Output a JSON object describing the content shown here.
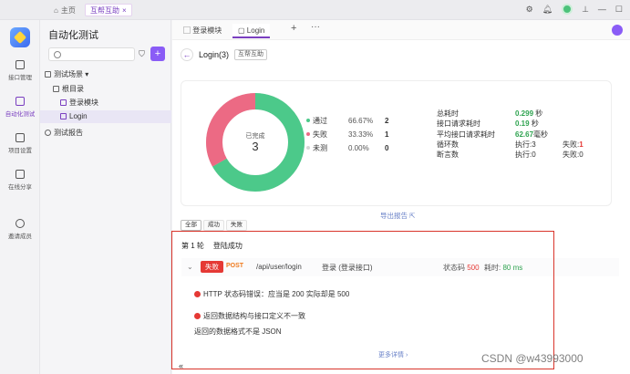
{
  "topbar": {
    "home_tab": "主页",
    "active_tab": "互帮互助"
  },
  "rail": {
    "items": [
      {
        "label": "接口管理"
      },
      {
        "label": "自动化测试"
      },
      {
        "label": "项目设置"
      },
      {
        "label": "在线分享"
      },
      {
        "label": "邀请成员"
      }
    ]
  },
  "tree": {
    "title": "自动化测试",
    "scene_group": "测试场景",
    "root": "根目录",
    "items": [
      "登录模块",
      "Login"
    ],
    "report": "测试报告"
  },
  "main": {
    "tabs": [
      "登录模块",
      "Login"
    ],
    "breadcrumb_title": "Login(3)",
    "breadcrumb_chip": "互帮互助"
  },
  "summary": {
    "center_label": "已完成",
    "center_value": "3",
    "legend": [
      {
        "label": "通过",
        "pct": "66.67%",
        "count": "2",
        "color": "#4cc98a"
      },
      {
        "label": "失败",
        "pct": "33.33%",
        "count": "1",
        "color": "#ec6a84"
      },
      {
        "label": "未测",
        "pct": "0.00%",
        "count": "0",
        "color": "#d6d6d6"
      }
    ],
    "stats": [
      {
        "label": "总耗时",
        "value": "0.299",
        "unit": "秒"
      },
      {
        "label": "接口请求耗时",
        "value": "0.19",
        "unit": "秒"
      },
      {
        "label": "平均接口请求耗时",
        "value": "62.67",
        "unit": "毫秒"
      }
    ],
    "loop_label": "循环数",
    "loop_exec": "执行:3",
    "loop_fail_label": "失败:",
    "loop_fail_value": "1",
    "break_label": "断言数",
    "break_exec": "执行:0",
    "break_fail": "失败:0",
    "export": "导出报告"
  },
  "filters": [
    "全部",
    "成功",
    "失败"
  ],
  "round": {
    "title": "第 1 轮",
    "subtitle": "登陆成功"
  },
  "request": {
    "status": "失败",
    "method": "POST",
    "path": "/api/user/login",
    "name": "登录 (登录接口)",
    "status_code_label": "状态码",
    "status_code": "500",
    "elapsed_label": "耗时",
    "elapsed": "80 ms"
  },
  "errors": [
    "HTTP 状态码错误：应当是 200 实际却是 500",
    "返回数据结构与接口定义不一致"
  ],
  "error_detail": "返回的数据格式不是 JSON",
  "more_link": "更多详情",
  "watermark": "CSDN @w43993000",
  "colors": {
    "accent": "#7a3fc0",
    "pass": "#4cc98a",
    "fail": "#ec6a84",
    "untested": "#d6d6d6"
  }
}
